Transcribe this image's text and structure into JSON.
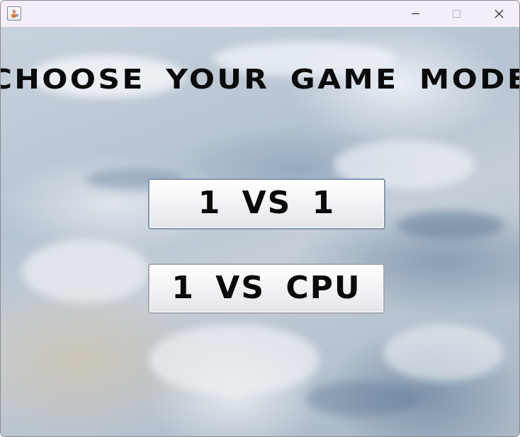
{
  "window": {
    "app_icon": "java-cup-icon",
    "controls": {
      "minimize_icon": "minimize-icon",
      "maximize_icon": "maximize-icon",
      "close_icon": "close-icon"
    }
  },
  "background": {
    "image": "earth-clouds-from-space"
  },
  "screen": {
    "title": "CHOOSE YOUR GAME MODE",
    "buttons": {
      "one_vs_one": "1 VS 1",
      "one_vs_cpu": "1 VS CPU"
    }
  },
  "colors": {
    "titlebar": "#f5eef8",
    "text": "#0a0a0a",
    "focused_button_border": "#7f97b3"
  }
}
